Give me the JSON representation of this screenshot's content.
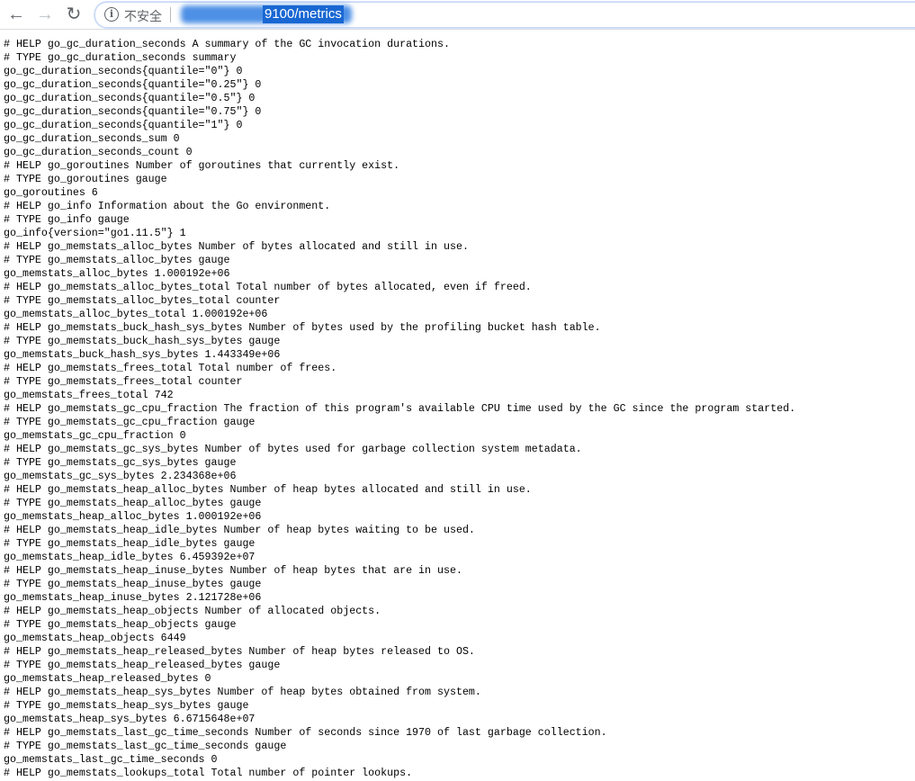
{
  "browser": {
    "security_label": "不安全",
    "url_path": "9100/metrics",
    "icons": {
      "back": "arrow-left",
      "forward": "arrow-right",
      "reload": "reload",
      "info": "info-circle"
    }
  },
  "lines": [
    "# HELP go_gc_duration_seconds A summary of the GC invocation durations.",
    "# TYPE go_gc_duration_seconds summary",
    "go_gc_duration_seconds{quantile=\"0\"} 0",
    "go_gc_duration_seconds{quantile=\"0.25\"} 0",
    "go_gc_duration_seconds{quantile=\"0.5\"} 0",
    "go_gc_duration_seconds{quantile=\"0.75\"} 0",
    "go_gc_duration_seconds{quantile=\"1\"} 0",
    "go_gc_duration_seconds_sum 0",
    "go_gc_duration_seconds_count 0",
    "# HELP go_goroutines Number of goroutines that currently exist.",
    "# TYPE go_goroutines gauge",
    "go_goroutines 6",
    "# HELP go_info Information about the Go environment.",
    "# TYPE go_info gauge",
    "go_info{version=\"go1.11.5\"} 1",
    "# HELP go_memstats_alloc_bytes Number of bytes allocated and still in use.",
    "# TYPE go_memstats_alloc_bytes gauge",
    "go_memstats_alloc_bytes 1.000192e+06",
    "# HELP go_memstats_alloc_bytes_total Total number of bytes allocated, even if freed.",
    "# TYPE go_memstats_alloc_bytes_total counter",
    "go_memstats_alloc_bytes_total 1.000192e+06",
    "# HELP go_memstats_buck_hash_sys_bytes Number of bytes used by the profiling bucket hash table.",
    "# TYPE go_memstats_buck_hash_sys_bytes gauge",
    "go_memstats_buck_hash_sys_bytes 1.443349e+06",
    "# HELP go_memstats_frees_total Total number of frees.",
    "# TYPE go_memstats_frees_total counter",
    "go_memstats_frees_total 742",
    "# HELP go_memstats_gc_cpu_fraction The fraction of this program's available CPU time used by the GC since the program started.",
    "# TYPE go_memstats_gc_cpu_fraction gauge",
    "go_memstats_gc_cpu_fraction 0",
    "# HELP go_memstats_gc_sys_bytes Number of bytes used for garbage collection system metadata.",
    "# TYPE go_memstats_gc_sys_bytes gauge",
    "go_memstats_gc_sys_bytes 2.234368e+06",
    "# HELP go_memstats_heap_alloc_bytes Number of heap bytes allocated and still in use.",
    "# TYPE go_memstats_heap_alloc_bytes gauge",
    "go_memstats_heap_alloc_bytes 1.000192e+06",
    "# HELP go_memstats_heap_idle_bytes Number of heap bytes waiting to be used.",
    "# TYPE go_memstats_heap_idle_bytes gauge",
    "go_memstats_heap_idle_bytes 6.459392e+07",
    "# HELP go_memstats_heap_inuse_bytes Number of heap bytes that are in use.",
    "# TYPE go_memstats_heap_inuse_bytes gauge",
    "go_memstats_heap_inuse_bytes 2.121728e+06",
    "# HELP go_memstats_heap_objects Number of allocated objects.",
    "# TYPE go_memstats_heap_objects gauge",
    "go_memstats_heap_objects 6449",
    "# HELP go_memstats_heap_released_bytes Number of heap bytes released to OS.",
    "# TYPE go_memstats_heap_released_bytes gauge",
    "go_memstats_heap_released_bytes 0",
    "# HELP go_memstats_heap_sys_bytes Number of heap bytes obtained from system.",
    "# TYPE go_memstats_heap_sys_bytes gauge",
    "go_memstats_heap_sys_bytes 6.6715648e+07",
    "# HELP go_memstats_last_gc_time_seconds Number of seconds since 1970 of last garbage collection.",
    "# TYPE go_memstats_last_gc_time_seconds gauge",
    "go_memstats_last_gc_time_seconds 0",
    "# HELP go_memstats_lookups_total Total number of pointer lookups."
  ]
}
